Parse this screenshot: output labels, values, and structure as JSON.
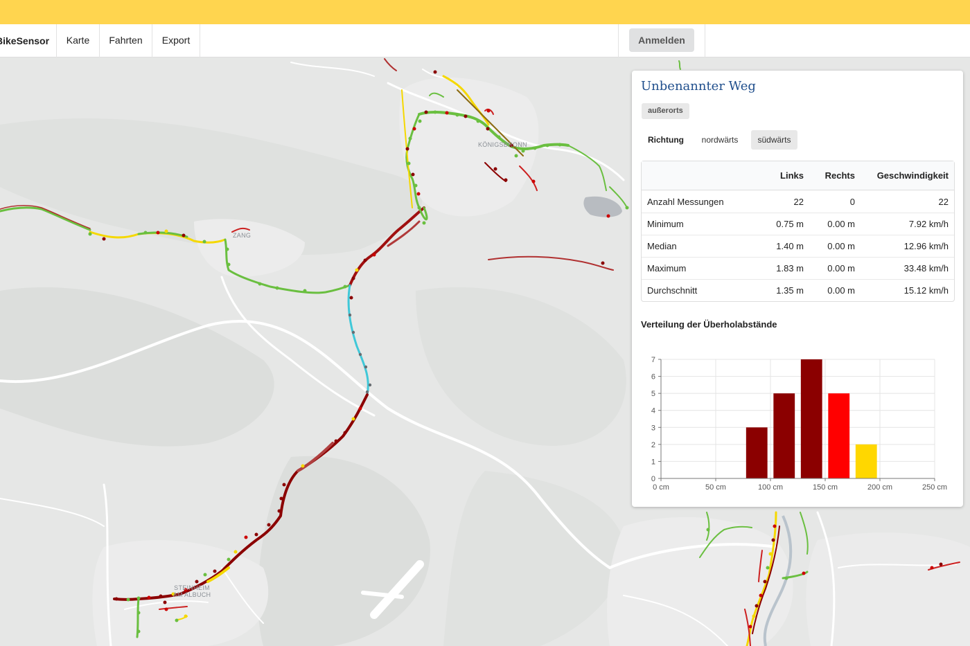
{
  "app": {
    "brand": "BikeSensor",
    "nav": [
      "Karte",
      "Fahrten",
      "Export"
    ],
    "login": "Anmelden"
  },
  "map": {
    "labels": [
      "ZANG",
      "KÖNIGSBRONN",
      "STEINHEIM AM ALBUCH"
    ]
  },
  "panel": {
    "title": "Unbenannter Weg",
    "badge": "außerorts",
    "direction_label": "Richtung",
    "directions": [
      "nordwärts",
      "südwärts"
    ],
    "active_direction": "südwärts",
    "table": {
      "headers": [
        "",
        "Links",
        "Rechts",
        "Geschwindigkeit"
      ],
      "rows": [
        [
          "Anzahl Messungen",
          "22",
          "0",
          "22"
        ],
        [
          "Minimum",
          "0.75 m",
          "0.00 m",
          "7.92 km/h"
        ],
        [
          "Median",
          "1.40 m",
          "0.00 m",
          "12.96 km/h"
        ],
        [
          "Maximum",
          "1.83 m",
          "0.00 m",
          "33.48 km/h"
        ],
        [
          "Durchschnitt",
          "1.35 m",
          "0.00 m",
          "15.12 km/h"
        ]
      ]
    },
    "chart_title": "Verteilung der Überholabstände"
  },
  "chart_data": {
    "type": "bar",
    "title": "Verteilung der Überholabstände",
    "xlim": [
      0,
      250
    ],
    "ylim": [
      0,
      7
    ],
    "x_ticks": [
      "0 cm",
      "50 cm",
      "100 cm",
      "150 cm",
      "200 cm",
      "250 cm"
    ],
    "y_ticks": [
      "0",
      "1",
      "2",
      "3",
      "4",
      "5",
      "6",
      "7"
    ],
    "bars": [
      {
        "x": 87.5,
        "value": 3,
        "color": "#8b0000"
      },
      {
        "x": 112.5,
        "value": 5,
        "color": "#8b0000"
      },
      {
        "x": 137.5,
        "value": 7,
        "color": "#8b0000"
      },
      {
        "x": 162.5,
        "value": 5,
        "color": "#ff0000"
      },
      {
        "x": 187.5,
        "value": 2,
        "color": "#ffd700"
      }
    ],
    "grid": true
  },
  "colors": {
    "topbar": "#ffd54f",
    "title": "#1f4e8c",
    "route_red": "#8b0000",
    "route_green": "#6abf40",
    "route_yellow": "#f5d800",
    "route_cyan": "#40c8d8"
  }
}
